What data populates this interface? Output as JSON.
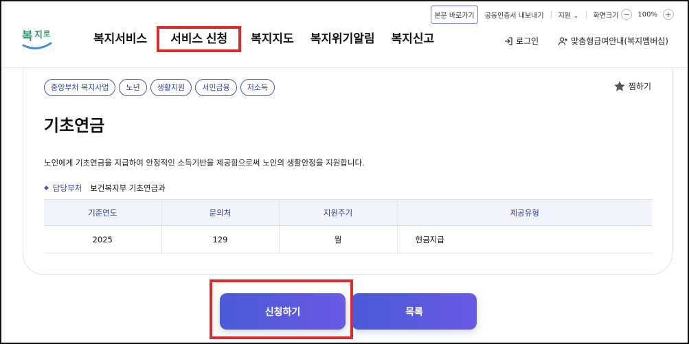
{
  "utility": {
    "skip_link": "본문 바로가기",
    "cert_export": "공동인증서 내보내기",
    "region": "지원",
    "zoom_label": "화면크기",
    "zoom_value": "100%"
  },
  "header": {
    "logo_text": "복지로",
    "nav": [
      "복지서비스",
      "서비스 신청",
      "복지지도",
      "복지위기알림",
      "복지신고"
    ],
    "login": "로그인",
    "membership": "맞춤형급여안내(복지멤버십)"
  },
  "service": {
    "tags": [
      "중앙부처 복지사업",
      "노년",
      "생활지원",
      "서민금융",
      "저소득"
    ],
    "favorite": "찜하기",
    "title": "기초연금",
    "description": "노인에게 기초연금을 지급하여 안정적인 소득기반을 제공함으로써 노인의 생활안정을 지원합니다.",
    "dept_label": "담당부처",
    "dept_value": "보건복지부 기초연금과",
    "table": {
      "headers": [
        "기준연도",
        "문의처",
        "지원주기",
        "제공유형"
      ],
      "row": [
        "2025",
        "129",
        "월",
        "현금지급"
      ]
    }
  },
  "actions": {
    "apply": "신청하기",
    "list": "목록"
  },
  "colors": {
    "accent": "#3f56c4",
    "highlight": "#e02a2a"
  }
}
